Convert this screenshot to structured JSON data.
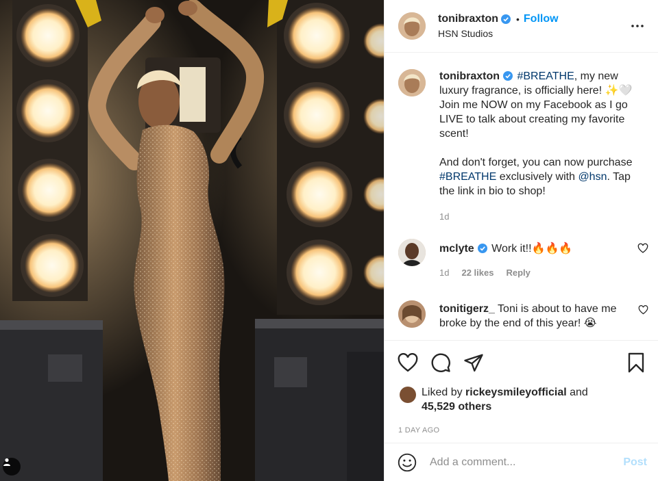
{
  "post": {
    "author": "tonibraxton",
    "follow_label": "Follow",
    "dot": "•",
    "location": "HSN Studios",
    "caption": {
      "username": "tonibraxton",
      "hashtag1": "#BREATHE",
      "text1": ", my new luxury fragrance, is officially here! ✨🤍 Join me NOW on my Facebook as I go LIVE to talk about creating my favorite scent!",
      "text2": "And don't forget, you can now purchase ",
      "hashtag2": "#BREATHE",
      "text3": " exclusively with ",
      "mention": "@hsn",
      "text4": ". Tap the link in bio to shop!",
      "age": "1d"
    },
    "comments": [
      {
        "username": "mclyte",
        "text": "Work it!!🔥🔥🔥",
        "age": "1d",
        "likes": "22 likes",
        "reply": "Reply"
      },
      {
        "username": "tonitigerz_",
        "text": "Toni is about to have me broke by the end of this year! 😭"
      }
    ],
    "liked_by": {
      "prefix": "Liked by ",
      "user": "rickeysmileyofficial",
      "and": " and",
      "others": "45,529 others"
    },
    "time_ago": "1 DAY AGO",
    "add_comment": {
      "placeholder": "Add a comment...",
      "post_label": "Post"
    }
  },
  "colors": {
    "accent": "#0095f6",
    "link": "#00376b",
    "muted": "#8e8e8e",
    "post_disabled": "#b2dffc"
  },
  "icons": [
    "user-tag-icon",
    "verified-badge-icon",
    "more-options-icon",
    "heart-icon",
    "comment-icon",
    "share-icon",
    "bookmark-icon",
    "emoji-icon"
  ]
}
